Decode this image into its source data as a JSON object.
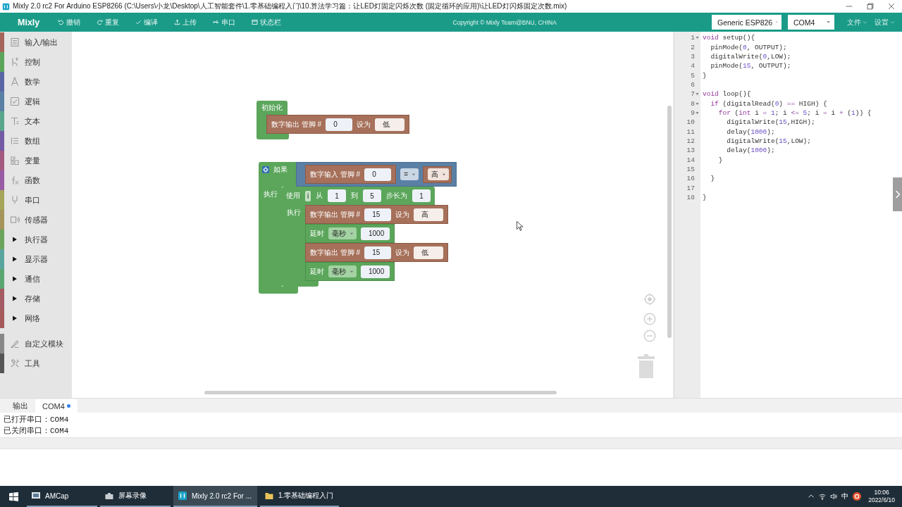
{
  "title_bar": {
    "title": "Mixly 2.0 rc2 For Arduino ESP8266 (C:\\Users\\小龙\\Desktop\\人工智能套件\\1.零基础编程入门\\10.算法学习篇：让LED灯固定闪烁次数 (固定循环的应用)\\让LED灯闪烁固定次数.mix)"
  },
  "toolbar": {
    "logo": "Mixly",
    "buttons": [
      "撤销",
      "重复",
      "编译",
      "上传",
      "串口",
      "状态栏"
    ],
    "copyright": "Copyright © Mixly Team@BNU, CHINA",
    "board_select": {
      "value": "Generic ESP826"
    },
    "port_select": {
      "value": "COM4"
    },
    "menus": [
      "文件",
      "设置"
    ]
  },
  "sidebar": {
    "sections": [
      {
        "items": [
          {
            "kind": "category",
            "label": "输入/输出",
            "color": "#a5655b"
          },
          {
            "kind": "category",
            "label": "控制",
            "color": "#5ba55b"
          },
          {
            "kind": "category",
            "label": "数学",
            "color": "#5b67a5"
          },
          {
            "kind": "category",
            "label": "逻辑",
            "color": "#5b80a5"
          },
          {
            "kind": "category",
            "label": "文本",
            "color": "#5ba58c"
          },
          {
            "kind": "category",
            "label": "数组",
            "color": "#745ba5"
          },
          {
            "kind": "category",
            "label": "变量",
            "color": "#a55b80"
          },
          {
            "kind": "category",
            "label": "函数",
            "color": "#995ba5"
          },
          {
            "kind": "category",
            "label": "串口",
            "color": "#a5a55b"
          },
          {
            "kind": "category",
            "label": "传感器",
            "color": "#a5945b"
          },
          {
            "kind": "group",
            "label": "执行器",
            "color": "#6aa55b",
            "expanded": false
          },
          {
            "kind": "group",
            "label": "显示器",
            "color": "#5ba5a0",
            "expanded": false
          },
          {
            "kind": "group",
            "label": "通信",
            "color": "#5ba570",
            "expanded": false
          },
          {
            "kind": "group",
            "label": "存储",
            "color": "#a55b64",
            "expanded": false
          },
          {
            "kind": "group",
            "label": "网络",
            "color": "#a55b5b",
            "expanded": false
          }
        ]
      },
      {
        "items": [
          {
            "kind": "category",
            "label": "自定义模块",
            "color": "#888888"
          },
          {
            "kind": "category",
            "label": "工具",
            "color": "#555555"
          }
        ]
      }
    ]
  },
  "workspace": {
    "stacks": [
      {
        "kind": "setup",
        "label": "初始化",
        "body": [
          {
            "kind": "digital_write",
            "label": "数字输出 管脚 #",
            "pin": "0",
            "set_label": "设为",
            "value": "低"
          }
        ]
      },
      {
        "kind": "if",
        "label": "如果",
        "condition": {
          "kind": "compare",
          "left": {
            "kind": "digital_read",
            "label": "数字输入 管脚 #",
            "pin": "0"
          },
          "operator": "=",
          "right": {
            "kind": "level",
            "value": "高"
          }
        },
        "do_label": "执行",
        "body": [
          {
            "kind": "for",
            "label": "使用",
            "variable": "i",
            "from_label": "从",
            "from": "1",
            "to_label": "到",
            "to": "5",
            "step_label": "步长为",
            "step": "1",
            "do_label": "执行",
            "body": [
              {
                "kind": "digital_write",
                "label": "数字输出 管脚 #",
                "pin": "15",
                "set_label": "设为",
                "value": "高"
              },
              {
                "kind": "delay",
                "label": "延时",
                "unit": "毫秒",
                "value": "1000"
              },
              {
                "kind": "digital_write",
                "label": "数字输出 管脚 #",
                "pin": "15",
                "set_label": "设为",
                "value": "低"
              },
              {
                "kind": "delay",
                "label": "延时",
                "unit": "毫秒",
                "value": "1000"
              }
            ]
          }
        ]
      }
    ]
  },
  "code_panel": {
    "lines": [
      {
        "number": "1",
        "foldable": true,
        "tokens": [
          {
            "kind": "keyword",
            "text": "void"
          },
          {
            "kind": "plain",
            "text": " setup(){"
          }
        ]
      },
      {
        "number": "2",
        "foldable": false,
        "tokens": [
          {
            "kind": "plain",
            "text": "  pinMode("
          },
          {
            "kind": "number",
            "text": "0"
          },
          {
            "kind": "plain",
            "text": ", OUTPUT);"
          }
        ]
      },
      {
        "number": "3",
        "foldable": false,
        "tokens": [
          {
            "kind": "plain",
            "text": "  digitalWrite("
          },
          {
            "kind": "number",
            "text": "0"
          },
          {
            "kind": "plain",
            "text": ",LOW);"
          }
        ]
      },
      {
        "number": "4",
        "foldable": false,
        "tokens": [
          {
            "kind": "plain",
            "text": "  pinMode("
          },
          {
            "kind": "number",
            "text": "15"
          },
          {
            "kind": "plain",
            "text": ", OUTPUT);"
          }
        ]
      },
      {
        "number": "5",
        "foldable": false,
        "tokens": [
          {
            "kind": "plain",
            "text": "}"
          }
        ]
      },
      {
        "number": "6",
        "foldable": false
      },
      {
        "number": "7",
        "foldable": true,
        "tokens": [
          {
            "kind": "keyword",
            "text": "void"
          },
          {
            "kind": "plain",
            "text": " loop(){"
          }
        ]
      },
      {
        "number": "8",
        "foldable": true,
        "tokens": [
          {
            "kind": "keyword",
            "text": "  if"
          },
          {
            "kind": "plain",
            "text": " (digitalRead("
          },
          {
            "kind": "number",
            "text": "0"
          },
          {
            "kind": "plain",
            "text": ") "
          },
          {
            "kind": "operator",
            "text": "=="
          },
          {
            "kind": "plain",
            "text": " HIGH) {"
          }
        ]
      },
      {
        "number": "9",
        "foldable": true,
        "tokens": [
          {
            "kind": "keyword",
            "text": "    for"
          },
          {
            "kind": "plain",
            "text": " ("
          },
          {
            "kind": "keyword",
            "text": "int"
          },
          {
            "kind": "plain",
            "text": " i "
          },
          {
            "kind": "operator",
            "text": "="
          },
          {
            "kind": "number",
            "text": " 1"
          },
          {
            "kind": "plain",
            "text": "; i "
          },
          {
            "kind": "operator",
            "text": "<="
          },
          {
            "kind": "number",
            "text": " 5"
          },
          {
            "kind": "plain",
            "text": "; i "
          },
          {
            "kind": "operator",
            "text": "="
          },
          {
            "kind": "plain",
            "text": " i "
          },
          {
            "kind": "operator",
            "text": "+"
          },
          {
            "kind": "plain",
            "text": " ("
          },
          {
            "kind": "number",
            "text": "1"
          },
          {
            "kind": "plain",
            "text": ")) {"
          }
        ]
      },
      {
        "number": "10",
        "foldable": false,
        "tokens": [
          {
            "kind": "plain",
            "text": "      digitalWrite("
          },
          {
            "kind": "number",
            "text": "15"
          },
          {
            "kind": "plain",
            "text": ",HIGH);"
          }
        ]
      },
      {
        "number": "11",
        "foldable": false,
        "tokens": [
          {
            "kind": "plain",
            "text": "      delay("
          },
          {
            "kind": "number",
            "text": "1000"
          },
          {
            "kind": "plain",
            "text": ");"
          }
        ]
      },
      {
        "number": "12",
        "foldable": false,
        "tokens": [
          {
            "kind": "plain",
            "text": "      digitalWrite("
          },
          {
            "kind": "number",
            "text": "15"
          },
          {
            "kind": "plain",
            "text": ",LOW);"
          }
        ]
      },
      {
        "number": "13",
        "foldable": false,
        "tokens": [
          {
            "kind": "plain",
            "text": "      delay("
          },
          {
            "kind": "number",
            "text": "1000"
          },
          {
            "kind": "plain",
            "text": ");"
          }
        ]
      },
      {
        "number": "14",
        "foldable": false,
        "tokens": [
          {
            "kind": "plain",
            "text": "    }"
          }
        ]
      },
      {
        "number": "15",
        "foldable": false
      },
      {
        "number": "16",
        "foldable": false,
        "tokens": [
          {
            "kind": "plain",
            "text": "  }"
          }
        ]
      },
      {
        "number": "17",
        "foldable": false
      },
      {
        "number": "18",
        "foldable": false,
        "tokens": [
          {
            "kind": "plain",
            "text": "}"
          }
        ]
      }
    ]
  },
  "output_panel": {
    "tabs": [
      {
        "label": "输出",
        "selected": false,
        "modified": false
      },
      {
        "label": "COM4",
        "selected": true,
        "modified": true
      }
    ],
    "lines": [
      "已打开串口：COM4",
      "已关闭串口：COM4"
    ]
  },
  "taskbar": {
    "apps": [
      {
        "label": "AMCap",
        "selected": false
      },
      {
        "label": "屏幕录像",
        "selected": false
      },
      {
        "label": "Mixly 2.0 rc2 For ...",
        "selected": true
      },
      {
        "label": "1.零基础编程入门",
        "selected": false
      }
    ],
    "ime": "中",
    "time": "10:06",
    "date": "2022/6/10"
  }
}
